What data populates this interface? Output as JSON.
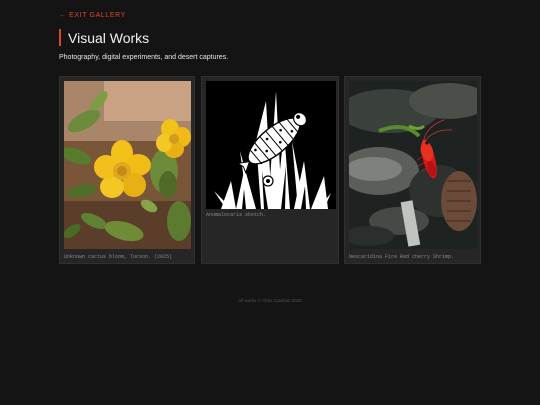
{
  "nav": {
    "exit_label": "← EXIT GALLERY"
  },
  "header": {
    "title": "Visual Works",
    "subtitle": "Photography, digital experiments, and desert captures."
  },
  "gallery": {
    "items": [
      {
        "caption": "Unknown cactus bloom, Tucson. (2025)",
        "icon": "cactus-flower-photo"
      },
      {
        "caption": "Anomalocaris sketch.",
        "icon": "anomalocaris-sketch"
      },
      {
        "caption": "Neocaridina Fire Red cherry Shrimp.",
        "icon": "shrimp-photo"
      }
    ]
  },
  "footer": {
    "text": "All works © Chris Calahan 2025"
  },
  "colors": {
    "accent": "#e0452a",
    "background": "#141414",
    "card": "#262626"
  }
}
